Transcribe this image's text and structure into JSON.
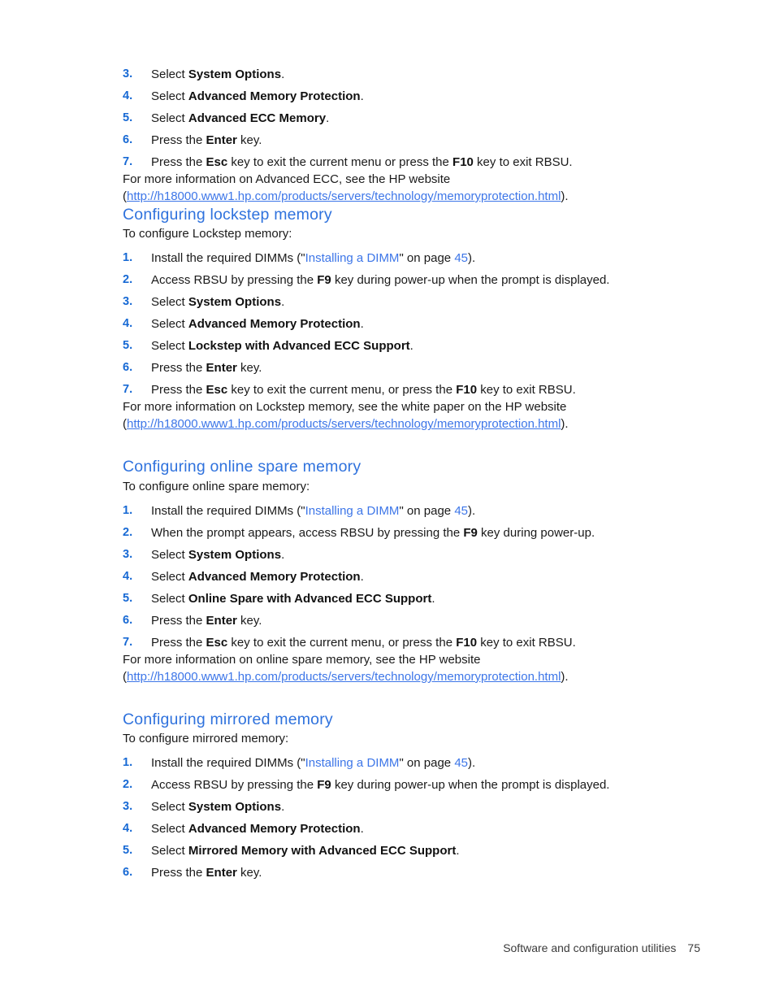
{
  "document": {
    "footer": {
      "chapter": "Software and configuration utilities",
      "page_number": "75"
    },
    "colors": {
      "heading_blue": "#2f72dd",
      "number_blue": "#1769d4",
      "link_blue": "#3d76e8",
      "body_text": "#1a1a1a",
      "page_background": "#ffffff"
    }
  },
  "continued_section": {
    "steps": [
      {
        "number": "3.",
        "parts": [
          {
            "t": "Select ",
            "style": "normal"
          },
          {
            "t": "System Options",
            "style": "bold"
          },
          {
            "t": ".",
            "style": "normal"
          }
        ]
      },
      {
        "number": "4.",
        "parts": [
          {
            "t": "Select ",
            "style": "normal"
          },
          {
            "t": "Advanced Memory Protection",
            "style": "bold"
          },
          {
            "t": ".",
            "style": "normal"
          }
        ]
      },
      {
        "number": "5.",
        "parts": [
          {
            "t": "Select ",
            "style": "normal"
          },
          {
            "t": "Advanced ECC Memory",
            "style": "bold"
          },
          {
            "t": ".",
            "style": "normal"
          }
        ]
      },
      {
        "number": "6.",
        "parts": [
          {
            "t": "Press the ",
            "style": "normal"
          },
          {
            "t": "Enter",
            "style": "bold"
          },
          {
            "t": " key.",
            "style": "normal"
          }
        ]
      },
      {
        "number": "7.",
        "parts": [
          {
            "t": "Press the ",
            "style": "normal"
          },
          {
            "t": "Esc",
            "style": "bold"
          },
          {
            "t": " key to exit the current menu or press the ",
            "style": "normal"
          },
          {
            "t": "F10",
            "style": "bold"
          },
          {
            "t": " key to exit RBSU.",
            "style": "normal"
          }
        ]
      }
    ],
    "note": {
      "line1": "For more information on Advanced ECC, see the HP website",
      "open_paren": "(",
      "url": "http://h18000.www1.hp.com/products/servers/technology/memoryprotection.html",
      "close": ")."
    }
  },
  "sections": [
    {
      "id": "lockstep",
      "heading": "Configuring lockstep memory",
      "intro": "To configure Lockstep memory:",
      "steps": [
        {
          "number": "1.",
          "parts": [
            {
              "t": "Install the required DIMMs (\"",
              "style": "normal"
            },
            {
              "t": "Installing a DIMM",
              "style": "link"
            },
            {
              "t": "\" on page ",
              "style": "normal"
            },
            {
              "t": "45",
              "style": "link"
            },
            {
              "t": ").",
              "style": "normal"
            }
          ]
        },
        {
          "number": "2.",
          "parts": [
            {
              "t": "Access RBSU by pressing the ",
              "style": "normal"
            },
            {
              "t": "F9",
              "style": "bold"
            },
            {
              "t": " key during power-up when the prompt is displayed.",
              "style": "normal"
            }
          ]
        },
        {
          "number": "3.",
          "parts": [
            {
              "t": "Select ",
              "style": "normal"
            },
            {
              "t": "System Options",
              "style": "bold"
            },
            {
              "t": ".",
              "style": "normal"
            }
          ]
        },
        {
          "number": "4.",
          "parts": [
            {
              "t": "Select ",
              "style": "normal"
            },
            {
              "t": "Advanced Memory Protection",
              "style": "bold"
            },
            {
              "t": ".",
              "style": "normal"
            }
          ]
        },
        {
          "number": "5.",
          "parts": [
            {
              "t": "Select ",
              "style": "normal"
            },
            {
              "t": "Lockstep with Advanced ECC Support",
              "style": "bold"
            },
            {
              "t": ".",
              "style": "normal"
            }
          ]
        },
        {
          "number": "6.",
          "parts": [
            {
              "t": "Press the ",
              "style": "normal"
            },
            {
              "t": "Enter",
              "style": "bold"
            },
            {
              "t": " key.",
              "style": "normal"
            }
          ]
        },
        {
          "number": "7.",
          "parts": [
            {
              "t": "Press the ",
              "style": "normal"
            },
            {
              "t": "Esc",
              "style": "bold"
            },
            {
              "t": " key to exit the current menu, or press the ",
              "style": "normal"
            },
            {
              "t": "F10",
              "style": "bold"
            },
            {
              "t": " key to exit RBSU.",
              "style": "normal"
            }
          ]
        }
      ],
      "note": {
        "line1": "For more information on Lockstep memory, see the white paper on the HP website",
        "open_paren": "(",
        "url": "http://h18000.www1.hp.com/products/servers/technology/memoryprotection.html",
        "close": ")."
      }
    },
    {
      "id": "online-spare",
      "heading": "Configuring online spare memory",
      "intro": "To configure online spare memory:",
      "steps": [
        {
          "number": "1.",
          "parts": [
            {
              "t": "Install the required DIMMs (\"",
              "style": "normal"
            },
            {
              "t": "Installing a DIMM",
              "style": "link"
            },
            {
              "t": "\" on page ",
              "style": "normal"
            },
            {
              "t": "45",
              "style": "link"
            },
            {
              "t": ").",
              "style": "normal"
            }
          ]
        },
        {
          "number": "2.",
          "parts": [
            {
              "t": "When the prompt appears, access RBSU by pressing the ",
              "style": "normal"
            },
            {
              "t": "F9",
              "style": "bold"
            },
            {
              "t": " key during power-up.",
              "style": "normal"
            }
          ]
        },
        {
          "number": "3.",
          "parts": [
            {
              "t": "Select ",
              "style": "normal"
            },
            {
              "t": "System Options",
              "style": "bold"
            },
            {
              "t": ".",
              "style": "normal"
            }
          ]
        },
        {
          "number": "4.",
          "parts": [
            {
              "t": "Select ",
              "style": "normal"
            },
            {
              "t": "Advanced Memory Protection",
              "style": "bold"
            },
            {
              "t": ".",
              "style": "normal"
            }
          ]
        },
        {
          "number": "5.",
          "parts": [
            {
              "t": "Select ",
              "style": "normal"
            },
            {
              "t": "Online Spare with Advanced ECC Support",
              "style": "bold"
            },
            {
              "t": ".",
              "style": "normal"
            }
          ]
        },
        {
          "number": "6.",
          "parts": [
            {
              "t": "Press the ",
              "style": "normal"
            },
            {
              "t": "Enter",
              "style": "bold"
            },
            {
              "t": " key.",
              "style": "normal"
            }
          ]
        },
        {
          "number": "7.",
          "parts": [
            {
              "t": "Press the ",
              "style": "normal"
            },
            {
              "t": "Esc",
              "style": "bold"
            },
            {
              "t": " key to exit the current menu, or press the ",
              "style": "normal"
            },
            {
              "t": "F10",
              "style": "bold"
            },
            {
              "t": " key to exit RBSU.",
              "style": "normal"
            }
          ]
        }
      ],
      "note": {
        "line1": "For more information on online spare memory, see the HP website",
        "open_paren": "(",
        "url": "http://h18000.www1.hp.com/products/servers/technology/memoryprotection.html",
        "close": ")."
      }
    },
    {
      "id": "mirrored",
      "heading": "Configuring mirrored memory",
      "intro": "To configure mirrored memory:",
      "steps": [
        {
          "number": "1.",
          "parts": [
            {
              "t": "Install the required DIMMs (\"",
              "style": "normal"
            },
            {
              "t": "Installing a DIMM",
              "style": "link"
            },
            {
              "t": "\" on page ",
              "style": "normal"
            },
            {
              "t": "45",
              "style": "link"
            },
            {
              "t": ").",
              "style": "normal"
            }
          ]
        },
        {
          "number": "2.",
          "parts": [
            {
              "t": "Access RBSU by pressing the ",
              "style": "normal"
            },
            {
              "t": "F9",
              "style": "bold"
            },
            {
              "t": " key during power-up when the prompt is displayed.",
              "style": "normal"
            }
          ]
        },
        {
          "number": "3.",
          "parts": [
            {
              "t": "Select ",
              "style": "normal"
            },
            {
              "t": "System Options",
              "style": "bold"
            },
            {
              "t": ".",
              "style": "normal"
            }
          ]
        },
        {
          "number": "4.",
          "parts": [
            {
              "t": "Select ",
              "style": "normal"
            },
            {
              "t": "Advanced Memory Protection",
              "style": "bold"
            },
            {
              "t": ".",
              "style": "normal"
            }
          ]
        },
        {
          "number": "5.",
          "parts": [
            {
              "t": "Select ",
              "style": "normal"
            },
            {
              "t": "Mirrored Memory with Advanced ECC Support",
              "style": "bold"
            },
            {
              "t": ".",
              "style": "normal"
            }
          ]
        },
        {
          "number": "6.",
          "parts": [
            {
              "t": "Press the ",
              "style": "normal"
            },
            {
              "t": "Enter",
              "style": "bold"
            },
            {
              "t": " key.",
              "style": "normal"
            }
          ]
        }
      ],
      "note": null
    }
  ]
}
